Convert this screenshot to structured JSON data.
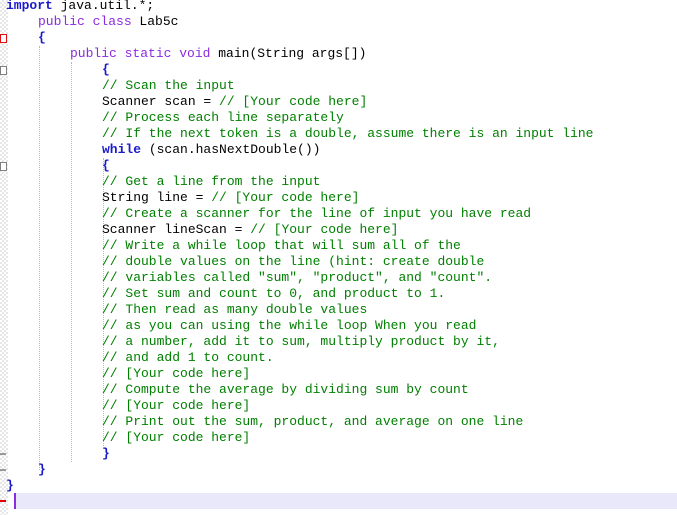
{
  "editor": {
    "language": "java",
    "class_name": "Lab5c",
    "lines": [
      {
        "indent": 0,
        "parts": [
          {
            "t": "kw",
            "v": "import"
          },
          {
            "t": "plain",
            "v": " java.util.*;"
          }
        ]
      },
      {
        "indent": 1,
        "parts": [
          {
            "t": "kw2",
            "v": "public class"
          },
          {
            "t": "plain",
            "v": " Lab5c"
          }
        ]
      },
      {
        "indent": 1,
        "parts": [
          {
            "t": "brace",
            "v": "{"
          }
        ]
      },
      {
        "indent": 2,
        "parts": [
          {
            "t": "kw2",
            "v": "public static void"
          },
          {
            "t": "plain",
            "v": " main(String args[])"
          }
        ]
      },
      {
        "indent": 3,
        "parts": [
          {
            "t": "brace",
            "v": "{"
          }
        ]
      },
      {
        "indent": 3,
        "parts": [
          {
            "t": "cm",
            "v": "// Scan the input"
          }
        ]
      },
      {
        "indent": 3,
        "parts": [
          {
            "t": "plain",
            "v": "Scanner scan = "
          },
          {
            "t": "cm",
            "v": "// [Your code here]"
          }
        ]
      },
      {
        "indent": 3,
        "parts": [
          {
            "t": "cm",
            "v": "// Process each line separately"
          }
        ]
      },
      {
        "indent": 3,
        "parts": [
          {
            "t": "cm",
            "v": "// If the next token is a double, assume there is an input line"
          }
        ]
      },
      {
        "indent": 3,
        "parts": [
          {
            "t": "kw",
            "v": "while"
          },
          {
            "t": "plain",
            "v": " (scan.hasNextDouble())"
          }
        ]
      },
      {
        "indent": 3,
        "parts": [
          {
            "t": "brace",
            "v": "{"
          }
        ]
      },
      {
        "indent": 3,
        "parts": [
          {
            "t": "cm",
            "v": "// Get a line from the input"
          }
        ]
      },
      {
        "indent": 3,
        "parts": [
          {
            "t": "plain",
            "v": "String line = "
          },
          {
            "t": "cm",
            "v": "// [Your code here]"
          }
        ]
      },
      {
        "indent": 3,
        "parts": [
          {
            "t": "cm",
            "v": "// Create a scanner for the line of input you have read"
          }
        ]
      },
      {
        "indent": 3,
        "parts": [
          {
            "t": "plain",
            "v": "Scanner lineScan = "
          },
          {
            "t": "cm",
            "v": "// [Your code here]"
          }
        ]
      },
      {
        "indent": 3,
        "parts": [
          {
            "t": "cm",
            "v": "// Write a while loop that will sum all of the"
          }
        ]
      },
      {
        "indent": 3,
        "parts": [
          {
            "t": "cm",
            "v": "// double values on the line (hint: create double"
          }
        ]
      },
      {
        "indent": 3,
        "parts": [
          {
            "t": "cm",
            "v": "// variables called \"sum\", \"product\", and \"count\"."
          }
        ]
      },
      {
        "indent": 3,
        "parts": [
          {
            "t": "cm",
            "v": "// Set sum and count to 0, and product to 1."
          }
        ]
      },
      {
        "indent": 3,
        "parts": [
          {
            "t": "cm",
            "v": "// Then read as many double values"
          }
        ]
      },
      {
        "indent": 3,
        "parts": [
          {
            "t": "cm",
            "v": "// as you can using the while loop When you read"
          }
        ]
      },
      {
        "indent": 3,
        "parts": [
          {
            "t": "cm",
            "v": "// a number, add it to sum, multiply product by it,"
          }
        ]
      },
      {
        "indent": 3,
        "parts": [
          {
            "t": "cm",
            "v": "// and add 1 to count."
          }
        ]
      },
      {
        "indent": 3,
        "parts": [
          {
            "t": "cm",
            "v": "// [Your code here]"
          }
        ]
      },
      {
        "indent": 3,
        "parts": [
          {
            "t": "cm",
            "v": "// Compute the average by dividing sum by count"
          }
        ]
      },
      {
        "indent": 3,
        "parts": [
          {
            "t": "cm",
            "v": "// [Your code here]"
          }
        ]
      },
      {
        "indent": 3,
        "parts": [
          {
            "t": "cm",
            "v": "// Print out the sum, product, and average on one line"
          }
        ]
      },
      {
        "indent": 3,
        "parts": [
          {
            "t": "cm",
            "v": "// [Your code here]"
          }
        ]
      },
      {
        "indent": 3,
        "parts": [
          {
            "t": "brace",
            "v": "}"
          }
        ]
      },
      {
        "indent": 1,
        "parts": [
          {
            "t": "brace",
            "v": "}"
          }
        ]
      },
      {
        "indent": 0,
        "parts": [
          {
            "t": "brace",
            "v": "}"
          }
        ]
      },
      {
        "indent": 0,
        "parts": []
      }
    ],
    "current_line_index": 31
  },
  "colors": {
    "keyword": "#1a1acc",
    "modifier": "#8a2be2",
    "comment": "#008000",
    "text": "#000000",
    "current_line_bg": "#e8e8fa"
  }
}
